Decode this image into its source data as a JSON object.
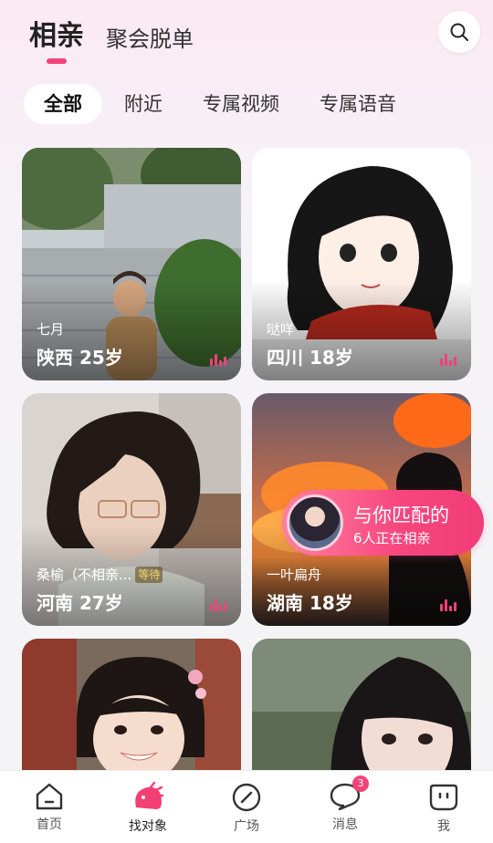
{
  "header": {
    "tabs": [
      {
        "label": "相亲",
        "active": true
      },
      {
        "label": "聚会脱单",
        "active": false
      }
    ]
  },
  "filters": [
    {
      "label": "全部",
      "active": true
    },
    {
      "label": "附近",
      "active": false
    },
    {
      "label": "专属视频",
      "active": false
    },
    {
      "label": "专属语音",
      "active": false
    }
  ],
  "cards": [
    {
      "nickname": "七月",
      "location": "陕西 25岁"
    },
    {
      "nickname": "哒咩",
      "location": "四川 18岁"
    },
    {
      "nickname": "桑榆（不相亲...",
      "status": "等待",
      "location": "河南 27岁"
    },
    {
      "nickname": "一叶扁舟",
      "location": "湖南 18岁"
    },
    {
      "nickname": "",
      "location": ""
    },
    {
      "nickname": "",
      "location": ""
    }
  ],
  "match_banner": {
    "title": "与你匹配的",
    "subtitle": "6人正在相亲"
  },
  "bottom_nav": {
    "items": [
      {
        "label": "首页",
        "icon": "home-icon"
      },
      {
        "label": "找对象",
        "icon": "find-partner-icon",
        "active": true
      },
      {
        "label": "广场",
        "icon": "compass-icon"
      },
      {
        "label": "消息",
        "icon": "message-icon",
        "badge": "3"
      },
      {
        "label": "我",
        "icon": "profile-icon"
      }
    ]
  },
  "colors": {
    "accent": "#f0437a",
    "background": "#f4f4f6"
  }
}
